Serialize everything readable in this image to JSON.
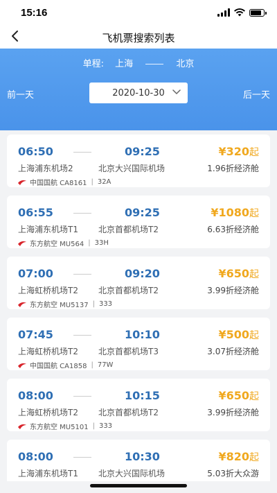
{
  "status": {
    "time": "15:16"
  },
  "nav": {
    "title": "飞机票搜索列表"
  },
  "route": {
    "prefix": "单程:",
    "from": "上海",
    "to": "北京"
  },
  "date": {
    "prev_label": "前一天",
    "next_label": "后一天",
    "value": "2020-10-30"
  },
  "flights": [
    {
      "dep_time": "06:50",
      "arr_time": "09:25",
      "price": "¥320",
      "suffix": "起",
      "dep_airport": "上海浦东机场2",
      "arr_airport": "北京大兴国际机场",
      "cabin": "1.96折经济舱",
      "airline": "中国国航 CA8161",
      "aircraft": "32A"
    },
    {
      "dep_time": "06:55",
      "arr_time": "09:25",
      "price": "¥1080",
      "suffix": "起",
      "dep_airport": "上海浦东机场T1",
      "arr_airport": "北京首都机场T2",
      "cabin": "6.63折经济舱",
      "airline": "东方航空 MU564",
      "aircraft": "33H"
    },
    {
      "dep_time": "07:00",
      "arr_time": "09:20",
      "price": "¥650",
      "suffix": "起",
      "dep_airport": "上海虹桥机场T2",
      "arr_airport": "北京首都机场T2",
      "cabin": "3.99折经济舱",
      "airline": "东方航空 MU5137",
      "aircraft": "333"
    },
    {
      "dep_time": "07:45",
      "arr_time": "10:10",
      "price": "¥500",
      "suffix": "起",
      "dep_airport": "上海虹桥机场T2",
      "arr_airport": "北京首都机场T3",
      "cabin": "3.07折经济舱",
      "airline": "中国国航 CA1858",
      "aircraft": "77W"
    },
    {
      "dep_time": "08:00",
      "arr_time": "10:15",
      "price": "¥650",
      "suffix": "起",
      "dep_airport": "上海虹桥机场T2",
      "arr_airport": "北京首都机场T2",
      "cabin": "3.99折经济舱",
      "airline": "东方航空 MU5101",
      "aircraft": "333"
    },
    {
      "dep_time": "08:00",
      "arr_time": "10:30",
      "price": "¥820",
      "suffix": "起",
      "dep_airport": "上海浦东机场T1",
      "arr_airport": "北京大兴国际机场",
      "cabin": "5.03折大众游",
      "airline": "",
      "aircraft": ""
    }
  ],
  "colors": {
    "accent_blue": "#4a93ea",
    "time_blue": "#2f6fb4",
    "price_orange": "#f0a81e",
    "airline_red": "#d8232a"
  },
  "icons": {
    "back": "chevron-left-icon",
    "date_dropdown": "chevron-down-icon",
    "airline_logo": "airline-logo-icon"
  }
}
